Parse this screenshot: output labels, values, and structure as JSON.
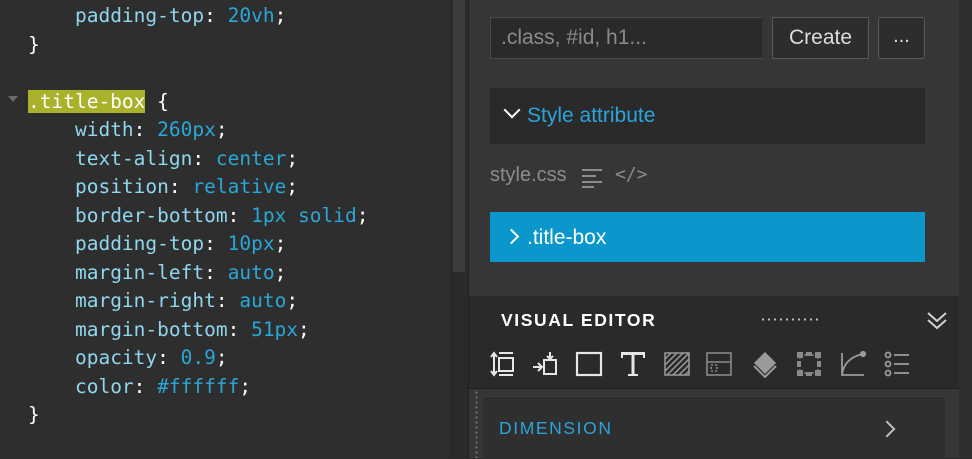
{
  "editor": {
    "lines": [
      {
        "indent": "    ",
        "prop": "padding-top",
        "val": "20vh"
      },
      {
        "text": "}"
      },
      {
        "text": ""
      },
      {
        "selector": ".title-box",
        "open": " {"
      },
      {
        "indent": "    ",
        "prop": "width",
        "val": "260px"
      },
      {
        "indent": "    ",
        "prop": "text-align",
        "val": "center"
      },
      {
        "indent": "    ",
        "prop": "position",
        "val": "relative"
      },
      {
        "indent": "    ",
        "prop": "border-bottom",
        "val": "1px solid"
      },
      {
        "indent": "    ",
        "prop": "padding-top",
        "val": "10px"
      },
      {
        "indent": "    ",
        "prop": "margin-left",
        "val": "auto"
      },
      {
        "indent": "    ",
        "prop": "margin-right",
        "val": "auto"
      },
      {
        "indent": "    ",
        "prop": "margin-bottom",
        "val": "51px"
      },
      {
        "indent": "    ",
        "prop": "opacity",
        "val": "0.9"
      },
      {
        "indent": "    ",
        "prop": "color",
        "val": "#ffffff"
      },
      {
        "text": "}"
      }
    ]
  },
  "panel": {
    "selector_placeholder": ".class, #id, h1...",
    "create_label": "Create",
    "more_label": "...",
    "style_attribute_label": "Style attribute",
    "stylesheet_name": "style.css",
    "code_icon_glyph": "</>",
    "rule_label": ".title-box",
    "visual_editor_title": "VISUAL EDITOR",
    "toolbar_icons": [
      "move-vertical-icon",
      "insert-box-icon",
      "border-box-icon",
      "text-icon",
      "background-icon",
      "layout-icon",
      "fill-icon",
      "transform-icon",
      "radius-icon",
      "list-icon"
    ],
    "dimension_label": "DIMENSION"
  },
  "colors": {
    "accent": "#2ba4dc",
    "selected_rule_bg": "#0b97cc",
    "selector_highlight": "#aab12a",
    "css_property": "#8fd6ef",
    "css_value": "#29a8d8"
  }
}
